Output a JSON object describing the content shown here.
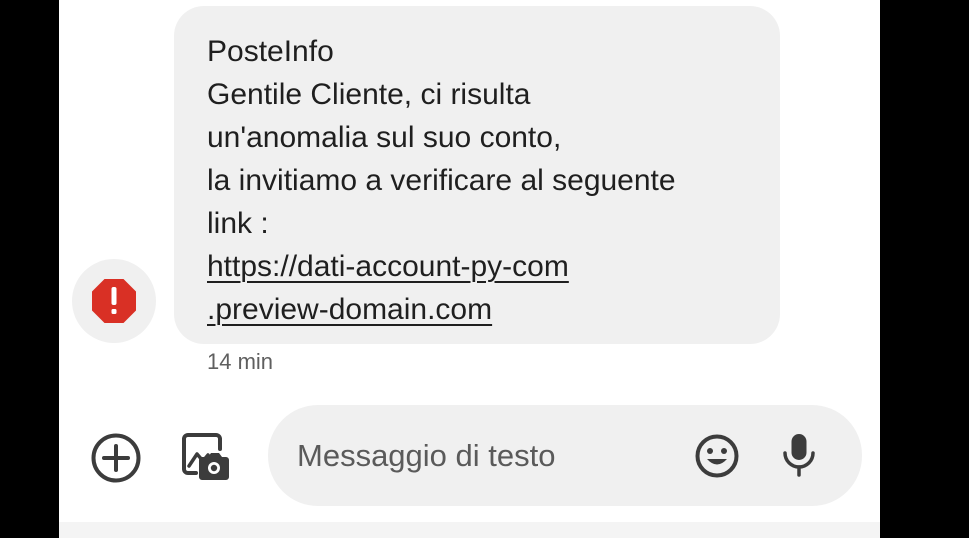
{
  "message": {
    "sender_alert_icon": "error-alert-icon",
    "lines": [
      "PosteInfo",
      "Gentile Cliente, ci risulta",
      "un'anomalia sul suo conto,",
      "la invitiamo a verificare al seguente",
      "link :"
    ],
    "link_lines": [
      "https://dati-account-py-com",
      ".preview-domain.com"
    ],
    "timestamp": "14 min"
  },
  "composer": {
    "placeholder": "Messaggio di testo",
    "add_icon": "add-circle-icon",
    "gallery_icon": "gallery-camera-icon",
    "emoji_icon": "emoji-icon",
    "mic_icon": "microphone-icon"
  },
  "colors": {
    "alert_red": "#d93025",
    "bubble_bg": "#f0f0f0",
    "icon_dark": "#3c3c3c"
  }
}
